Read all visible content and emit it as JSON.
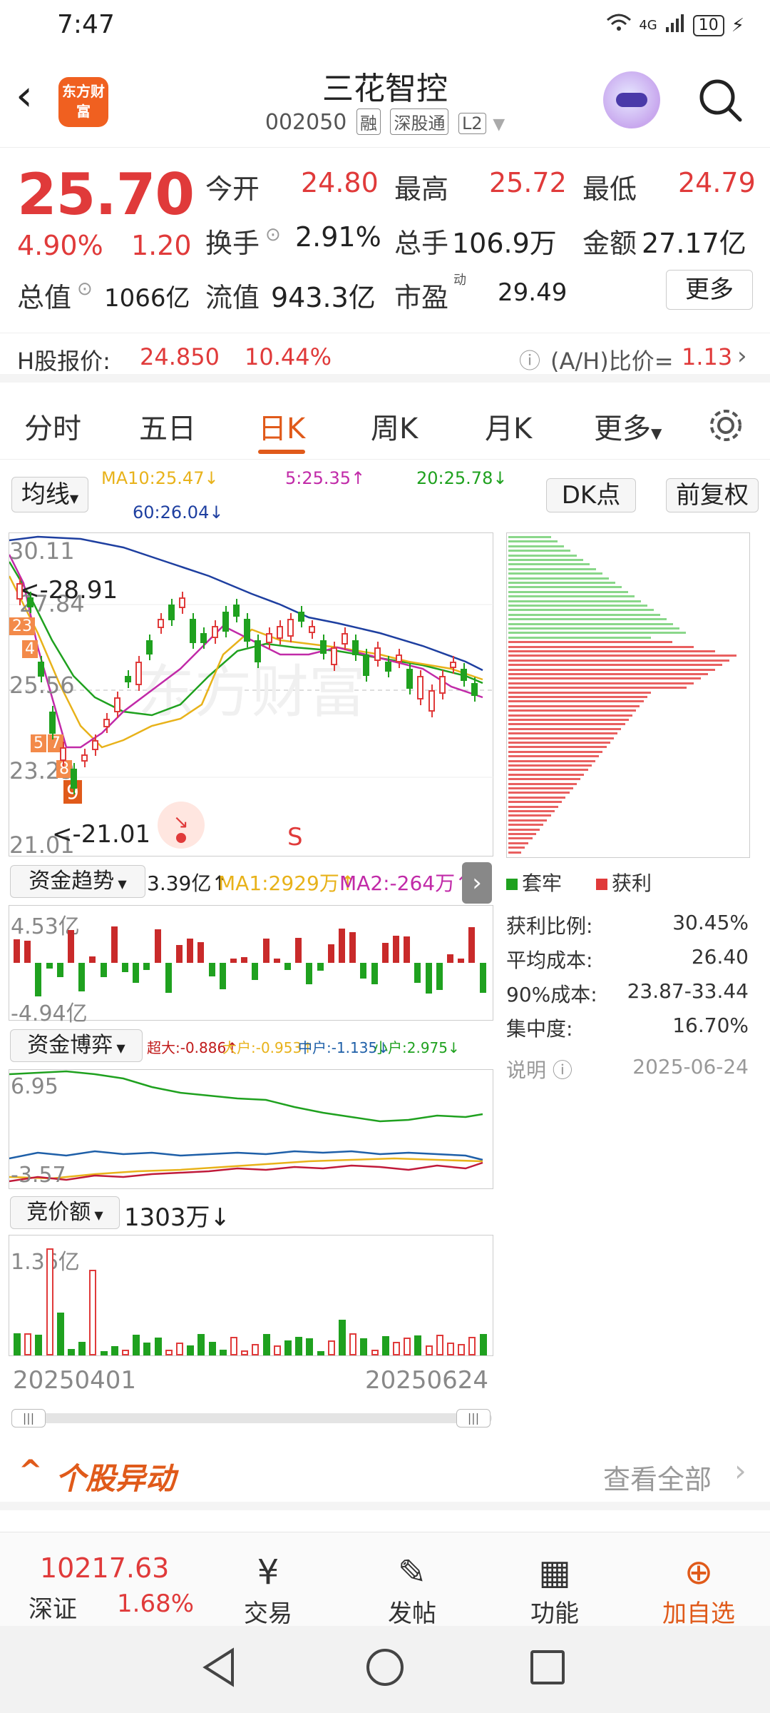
{
  "status": {
    "time": "7:47",
    "network": "4G",
    "battery": "10"
  },
  "header": {
    "logo_text": "东方财富",
    "title": "三花智控",
    "code": "002050",
    "tags": [
      "融",
      "深股通",
      "L2"
    ]
  },
  "quote": {
    "price": "25.70",
    "pct": "4.90%",
    "chg": "1.20",
    "open_label": "今开",
    "open": "24.80",
    "high_label": "最高",
    "high": "25.72",
    "low_label": "最低",
    "low": "24.79",
    "turnover_label": "换手",
    "turnover": "2.91%",
    "volume_label": "总手",
    "volume": "106.9万",
    "amount_label": "金额",
    "amount": "27.17亿",
    "mktcap_label": "总值",
    "mktcap": "1066亿",
    "float_label": "流值",
    "float": "943.3亿",
    "pe_label": "市盈",
    "pe_sup": "动",
    "pe": "29.49",
    "more": "更多"
  },
  "hshare": {
    "label": "H股报价:",
    "price": "24.850",
    "pct": "10.44%",
    "ah_label": "(A/H)比价=",
    "ah": "1.13"
  },
  "tabs": [
    "分时",
    "五日",
    "日K",
    "周K",
    "月K",
    "更多"
  ],
  "active_tab": "日K",
  "chart_controls": {
    "ma_btn": "均线",
    "ma10": "MA10:25.47↓",
    "ma5": "5:25.35↑",
    "ma20": "20:25.78↓",
    "ma60": "60:26.04↓",
    "dk": "DK点",
    "fq": "前复权"
  },
  "kline": {
    "y_labels": [
      "30.11",
      "27.84",
      "25.56",
      "23.29",
      "21.01"
    ],
    "max_note": "<-28.91",
    "min_note": "<-21.01",
    "sell_mark": "S",
    "chips": [
      "23",
      "4",
      "5",
      "7",
      "8",
      "9"
    ]
  },
  "chip_legend": {
    "trapped": "套牢",
    "profit": "获利"
  },
  "chip_stats": [
    {
      "label": "获利比例:",
      "value": "30.45%"
    },
    {
      "label": "平均成本:",
      "value": "26.40"
    },
    {
      "label": "90%成本:",
      "value": "23.87-33.44"
    },
    {
      "label": "集中度:",
      "value": "16.70%"
    }
  ],
  "chip_note": {
    "label": "说明",
    "date": "2025-06-24"
  },
  "fund_trend": {
    "title": "资金趋势",
    "value": "3.39亿↑",
    "ma1": "MA1:2929万↑",
    "ma2": "MA2:-264万↑",
    "top": "4.53亿",
    "bottom": "-4.94亿"
  },
  "fund_game": {
    "title": "资金博弈",
    "super": "超大:-0.886↑",
    "big": "大户:-0.953↑",
    "mid": "中户:-1.135↓",
    "small": "小户:2.975↓",
    "top": "6.95",
    "bottom": "-3.57"
  },
  "auction": {
    "title": "竞价额",
    "value": "1303万↓",
    "top": "1.36亿",
    "date_start": "20250401",
    "date_end": "20250624"
  },
  "abnormal": {
    "title": "个股异动",
    "more": "查看全部"
  },
  "bottom_nav": {
    "index_value": "10217.63",
    "index_name": "深证",
    "index_pct": "1.68%",
    "items": [
      "交易",
      "发帖",
      "功能",
      "加自选"
    ]
  },
  "colors": {
    "up": "#e03a3a",
    "down": "#1fa11f",
    "accent": "#e05a1a"
  }
}
